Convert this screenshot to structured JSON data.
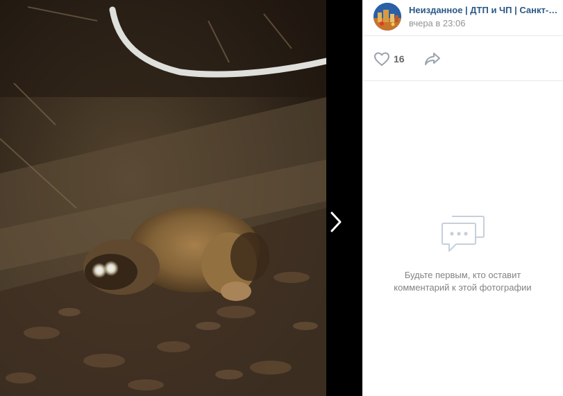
{
  "post": {
    "author": "Неизданное | ДТП и ЧП | Санкт-Петербург",
    "date": "вчера в 23:06",
    "likes": "16"
  },
  "comments": {
    "empty_line1": "Будьте первым, кто оставит",
    "empty_line2": "комментарий к этой фотографии"
  },
  "colors": {
    "link": "#2a5885",
    "muted": "#939393",
    "divider": "#e7e8ec",
    "icon": "#b7bec8"
  },
  "icons": {
    "like": "heart-icon",
    "share": "share-arrow-icon",
    "next": "chevron-right-icon",
    "empty": "comments-bubble-icon"
  }
}
